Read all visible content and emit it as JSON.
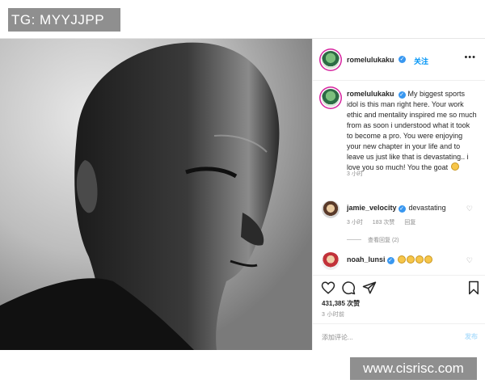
{
  "overlay": {
    "tg_badge": "TG: MYYJJPP",
    "watermark": "www.cisrisc.com"
  },
  "post": {
    "header": {
      "username": "romelulukaku",
      "follow_label": "关注",
      "more_icon": "more-horizontal-icon"
    },
    "caption": {
      "username": "romelulukaku",
      "text": "My biggest sports idol is this man right here. Your work ethic and mentality inspired me so much from as soon i understood what it took to become a pro. You were enjoying your new chapter in your life and to leave us just like that is devastating.. i love you so much! You the goat",
      "time": "3 小时"
    },
    "comments": [
      {
        "username": "jamie_velocity",
        "text": "devastating",
        "time": "3 小时",
        "likes": "183 次赞",
        "reply": "回复",
        "view_replies": "查看回复 (2)"
      },
      {
        "username": "noah_lunsi",
        "text": ""
      }
    ],
    "likes": "431,385 次赞",
    "time": "3 小时前",
    "add_comment": {
      "placeholder": "添加评论...",
      "publish_label": "发布"
    }
  },
  "colors": {
    "accent": "#0095f6",
    "verified": "#3897f0",
    "badge_bg": "#8f8f8f"
  }
}
